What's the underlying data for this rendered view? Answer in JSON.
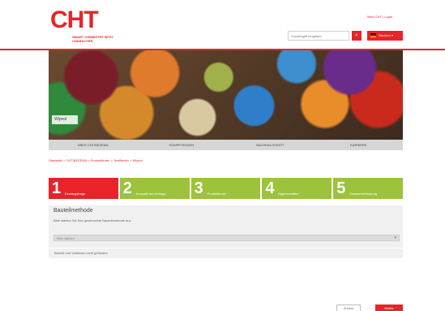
{
  "brand": {
    "logo_text": "CHT",
    "tagline": "SMART CHEMISTRY WITH CHARACTER.",
    "color": "#e8232a"
  },
  "header": {
    "login_link": "Mein CHT | Login",
    "search_placeholder": "Suchbegriff eingeben",
    "search_icon": "magnifier-icon",
    "language": "Deutsch"
  },
  "hero": {
    "caption": "Wipeol"
  },
  "nav": {
    "items": [
      "Über CHT/BEZEMA",
      "Kompetenzen",
      "Nachhaltigkeit",
      "Karriere"
    ]
  },
  "breadcrumb": "Startseite > CHT/BEZEMA > Produktfinder > Textilfinder > Wipeol",
  "steps": [
    {
      "number": "1",
      "label": "Einstiegsfrage",
      "active": true
    },
    {
      "number": "2",
      "label": "Auswahl der Anfrage",
      "active": false
    },
    {
      "number": "3",
      "label": "Produktionen",
      "active": false
    },
    {
      "number": "4",
      "label": "Eigenschaften",
      "active": false
    },
    {
      "number": "5",
      "label": "Zusammenfassung",
      "active": false
    }
  ],
  "form": {
    "title": "Bauteilmethode",
    "subtitle": "Bitte wählen Sie Ihre gewünschte Bauteilmethode aus",
    "select_value": "Bitte wählen",
    "note": "Bauteil und Verfahren nicht gefunden"
  },
  "buttons": {
    "back": "Zurück",
    "next": "Weiter"
  }
}
